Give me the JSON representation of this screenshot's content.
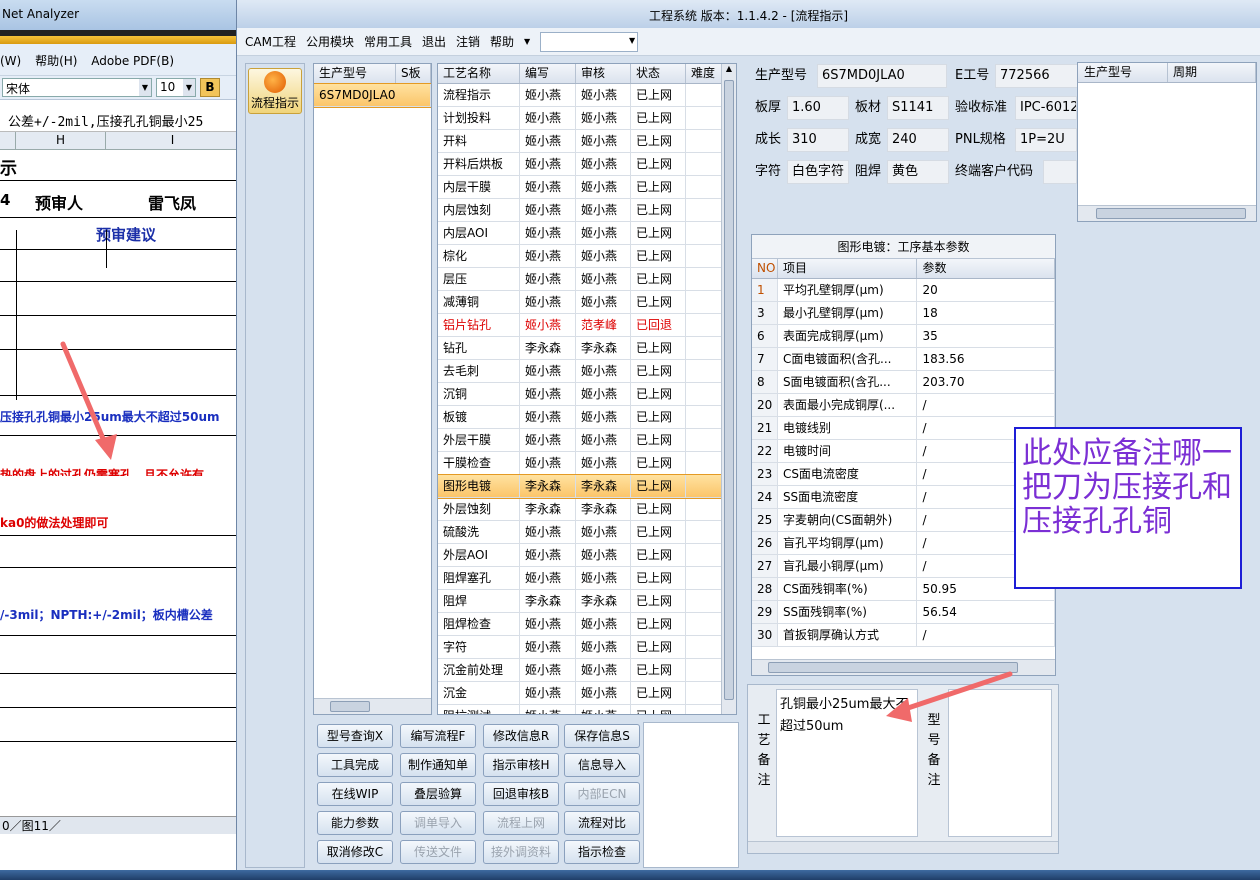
{
  "background_app": {
    "title": "Net Analyzer",
    "menu": [
      "(W)",
      "帮助(H)",
      "Adobe PDF(B)"
    ],
    "font_name": "宋体",
    "font_size": "10",
    "bold_label": "B",
    "formula_text": "公差+/-2mil,压接孔孔铜最小25",
    "col_h": "H",
    "col_i": "I",
    "row_title": "示",
    "row_reviewer_num": "4",
    "row_reviewer_label": "预审人",
    "row_reviewer_name": "雷飞凤",
    "row_advice": "预审建议",
    "line1": "压接孔孔铜最小25um最大不超过50um",
    "line2": "热的盘上的过孔仍需塞孔，且不允许有",
    "line3": "ka0的做法处理即可",
    "line4": "/-3mil；NPTH:+/-2mil；板内槽公差",
    "sheet_tabs": "0／图11／"
  },
  "window": {
    "title": "工程系统   版本：1.1.4.2 - [流程指示]"
  },
  "menu": [
    "CAM工程",
    "公用模块",
    "常用工具",
    "退出",
    "注销",
    "帮助"
  ],
  "sidenav": {
    "flow_label": "流程指示"
  },
  "model_grid": {
    "headers": [
      "生产型号",
      "S板"
    ],
    "rows": [
      [
        "6S7MD0JLA0",
        ""
      ]
    ]
  },
  "process_grid": {
    "headers": [
      "工艺名称",
      "编写",
      "审核",
      "状态",
      "难度"
    ],
    "rows": [
      [
        "流程指示",
        "姬小燕",
        "姬小燕",
        "已上网",
        ""
      ],
      [
        "计划投料",
        "姬小燕",
        "姬小燕",
        "已上网",
        ""
      ],
      [
        "开料",
        "姬小燕",
        "姬小燕",
        "已上网",
        ""
      ],
      [
        "开料后烘板",
        "姬小燕",
        "姬小燕",
        "已上网",
        ""
      ],
      [
        "内层干膜",
        "姬小燕",
        "姬小燕",
        "已上网",
        ""
      ],
      [
        "内层蚀刻",
        "姬小燕",
        "姬小燕",
        "已上网",
        ""
      ],
      [
        "内层AOI",
        "姬小燕",
        "姬小燕",
        "已上网",
        ""
      ],
      [
        "棕化",
        "姬小燕",
        "姬小燕",
        "已上网",
        ""
      ],
      [
        "层压",
        "姬小燕",
        "姬小燕",
        "已上网",
        ""
      ],
      [
        "减薄铜",
        "姬小燕",
        "姬小燕",
        "已上网",
        ""
      ],
      [
        "铝片钻孔",
        "姬小燕",
        "范孝峰",
        "已回退",
        ""
      ],
      [
        "钻孔",
        "李永森",
        "李永森",
        "已上网",
        ""
      ],
      [
        "去毛刺",
        "姬小燕",
        "姬小燕",
        "已上网",
        ""
      ],
      [
        "沉铜",
        "姬小燕",
        "姬小燕",
        "已上网",
        ""
      ],
      [
        "板镀",
        "姬小燕",
        "姬小燕",
        "已上网",
        ""
      ],
      [
        "外层干膜",
        "姬小燕",
        "姬小燕",
        "已上网",
        ""
      ],
      [
        "干膜检查",
        "姬小燕",
        "姬小燕",
        "已上网",
        ""
      ],
      [
        "图形电镀",
        "李永森",
        "李永森",
        "已上网",
        ""
      ],
      [
        "外层蚀刻",
        "李永森",
        "李永森",
        "已上网",
        ""
      ],
      [
        "硫酸洗",
        "姬小燕",
        "姬小燕",
        "已上网",
        ""
      ],
      [
        "外层AOI",
        "姬小燕",
        "姬小燕",
        "已上网",
        ""
      ],
      [
        "阻焊塞孔",
        "姬小燕",
        "姬小燕",
        "已上网",
        ""
      ],
      [
        "阻焊",
        "李永森",
        "李永森",
        "已上网",
        ""
      ],
      [
        "阻焊检查",
        "姬小燕",
        "姬小燕",
        "已上网",
        ""
      ],
      [
        "字符",
        "姬小燕",
        "姬小燕",
        "已上网",
        ""
      ],
      [
        "沉金前处理",
        "姬小燕",
        "姬小燕",
        "已上网",
        ""
      ],
      [
        "沉金",
        "姬小燕",
        "姬小燕",
        "已上网",
        ""
      ],
      [
        "阻抗测试",
        "姬小燕",
        "姬小燕",
        "已上网",
        ""
      ]
    ],
    "selected_index": 17,
    "red_index": 10
  },
  "buttons": [
    [
      "型号查询X",
      "编写流程F",
      "修改信息R",
      "保存信息S"
    ],
    [
      "工具完成",
      "制作通知单",
      "指示审核H",
      "信息导入"
    ],
    [
      "在线WIP",
      "叠层验算",
      "回退审核B",
      "内部ECN"
    ],
    [
      "能力参数",
      "调单导入",
      "流程上网",
      "流程对比"
    ],
    [
      "取消修改C",
      "传送文件",
      "接外调资料",
      "指示检查"
    ]
  ],
  "disabled_buttons": [
    "内部ECN",
    "调单导入",
    "流程上网",
    "传送文件",
    "接外调资料"
  ],
  "info": {
    "model_label": "生产型号",
    "model_value": "6S7MD0JLA0",
    "e_label": "E工号",
    "e_value": "772566",
    "thick_label": "板厚",
    "thick_value": "1.60",
    "mat_label": "板材",
    "mat_value": "S1141",
    "std_label": "验收标准",
    "std_value": "IPC-6012",
    "len_label": "成长",
    "len_value": "310",
    "wid_label": "成宽",
    "wid_value": "240",
    "pnl_label": "PNL规格",
    "pnl_value": "1P=2U",
    "char_label": "字符",
    "char_value": "白色字符",
    "mask_label": "阻焊",
    "mask_value": "黄色",
    "cust_label": "终端客户代码",
    "cust_value": ""
  },
  "right_grid_headers": [
    "生产型号",
    "周期"
  ],
  "params": {
    "caption": "图形电镀：工序基本参数",
    "headers": [
      "NO",
      "项目",
      "参数"
    ],
    "rows": [
      [
        "1",
        "平均孔壁铜厚(μm)",
        "20"
      ],
      [
        "3",
        "最小孔壁铜厚(μm)",
        "18"
      ],
      [
        "6",
        "表面完成铜厚(μm)",
        "35"
      ],
      [
        "7",
        "C面电镀面积(含孔...",
        "183.56"
      ],
      [
        "8",
        "S面电镀面积(含孔...",
        "203.70"
      ],
      [
        "20",
        "表面最小完成铜厚(...",
        "/"
      ],
      [
        "21",
        "电镀线别",
        "/"
      ],
      [
        "22",
        "电镀时间",
        "/"
      ],
      [
        "23",
        "CS面电流密度",
        "/"
      ],
      [
        "24",
        "SS面电流密度",
        "/"
      ],
      [
        "25",
        "字麦朝向(CS面朝外)",
        "/"
      ],
      [
        "26",
        "盲孔平均铜厚(μm)",
        "/"
      ],
      [
        "27",
        "盲孔最小铜厚(μm)",
        "/"
      ],
      [
        "28",
        "CS面残铜率(%)",
        "50.95"
      ],
      [
        "29",
        "SS面残铜率(%)",
        "56.54"
      ],
      [
        "30",
        "首扳铜厚确认方式",
        "/"
      ]
    ]
  },
  "remarks": {
    "process_label": "工艺备注",
    "process_text": "孔铜最小25um最大不超过50um",
    "model_label": "型号备注"
  },
  "annotation": "此处应备注哪一把刀为压接孔和压接孔孔铜",
  "colors": {
    "annotation_text": "#7b2fd4",
    "annotation_border": "#1d1dd6",
    "arrow": "#f06a6a",
    "selected_row": "#fbc56a",
    "returned_row": "#dd0000"
  }
}
